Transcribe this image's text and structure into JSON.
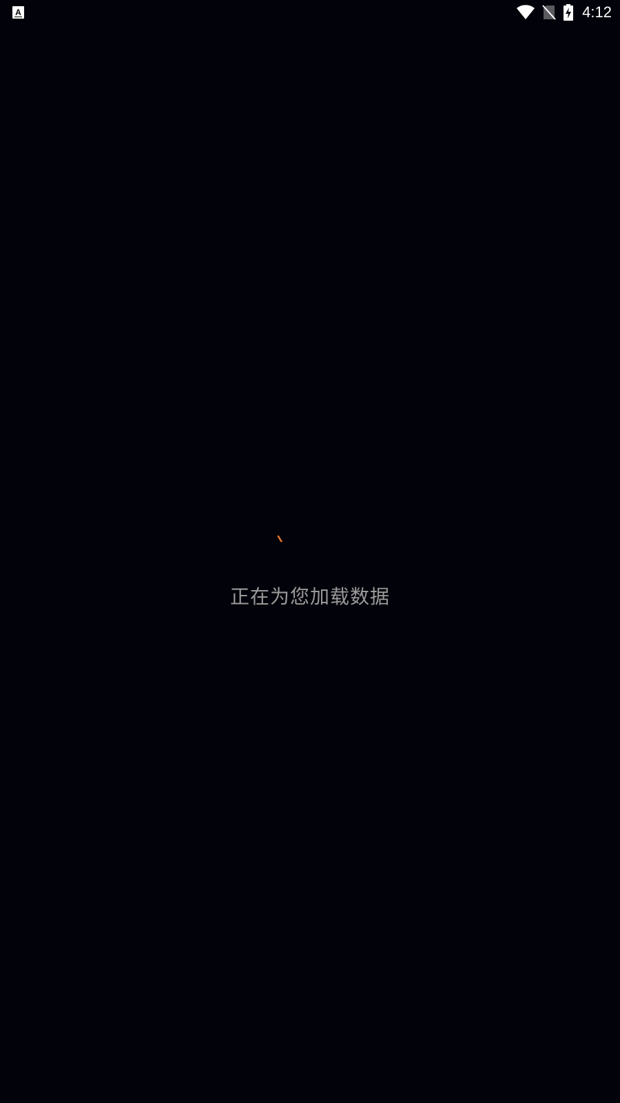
{
  "status_bar": {
    "time": "4:12",
    "notification_icon": "app-notification-icon",
    "wifi_icon": "wifi-icon",
    "sim_icon": "no-sim-icon",
    "battery_icon": "battery-charging-icon"
  },
  "loading": {
    "spinner_icon": "loading-spinner-icon",
    "spinner_color": "#e8762a",
    "message": "正在为您加载数据"
  },
  "colors": {
    "background": "#02020a",
    "text": "#9a9a9a"
  }
}
